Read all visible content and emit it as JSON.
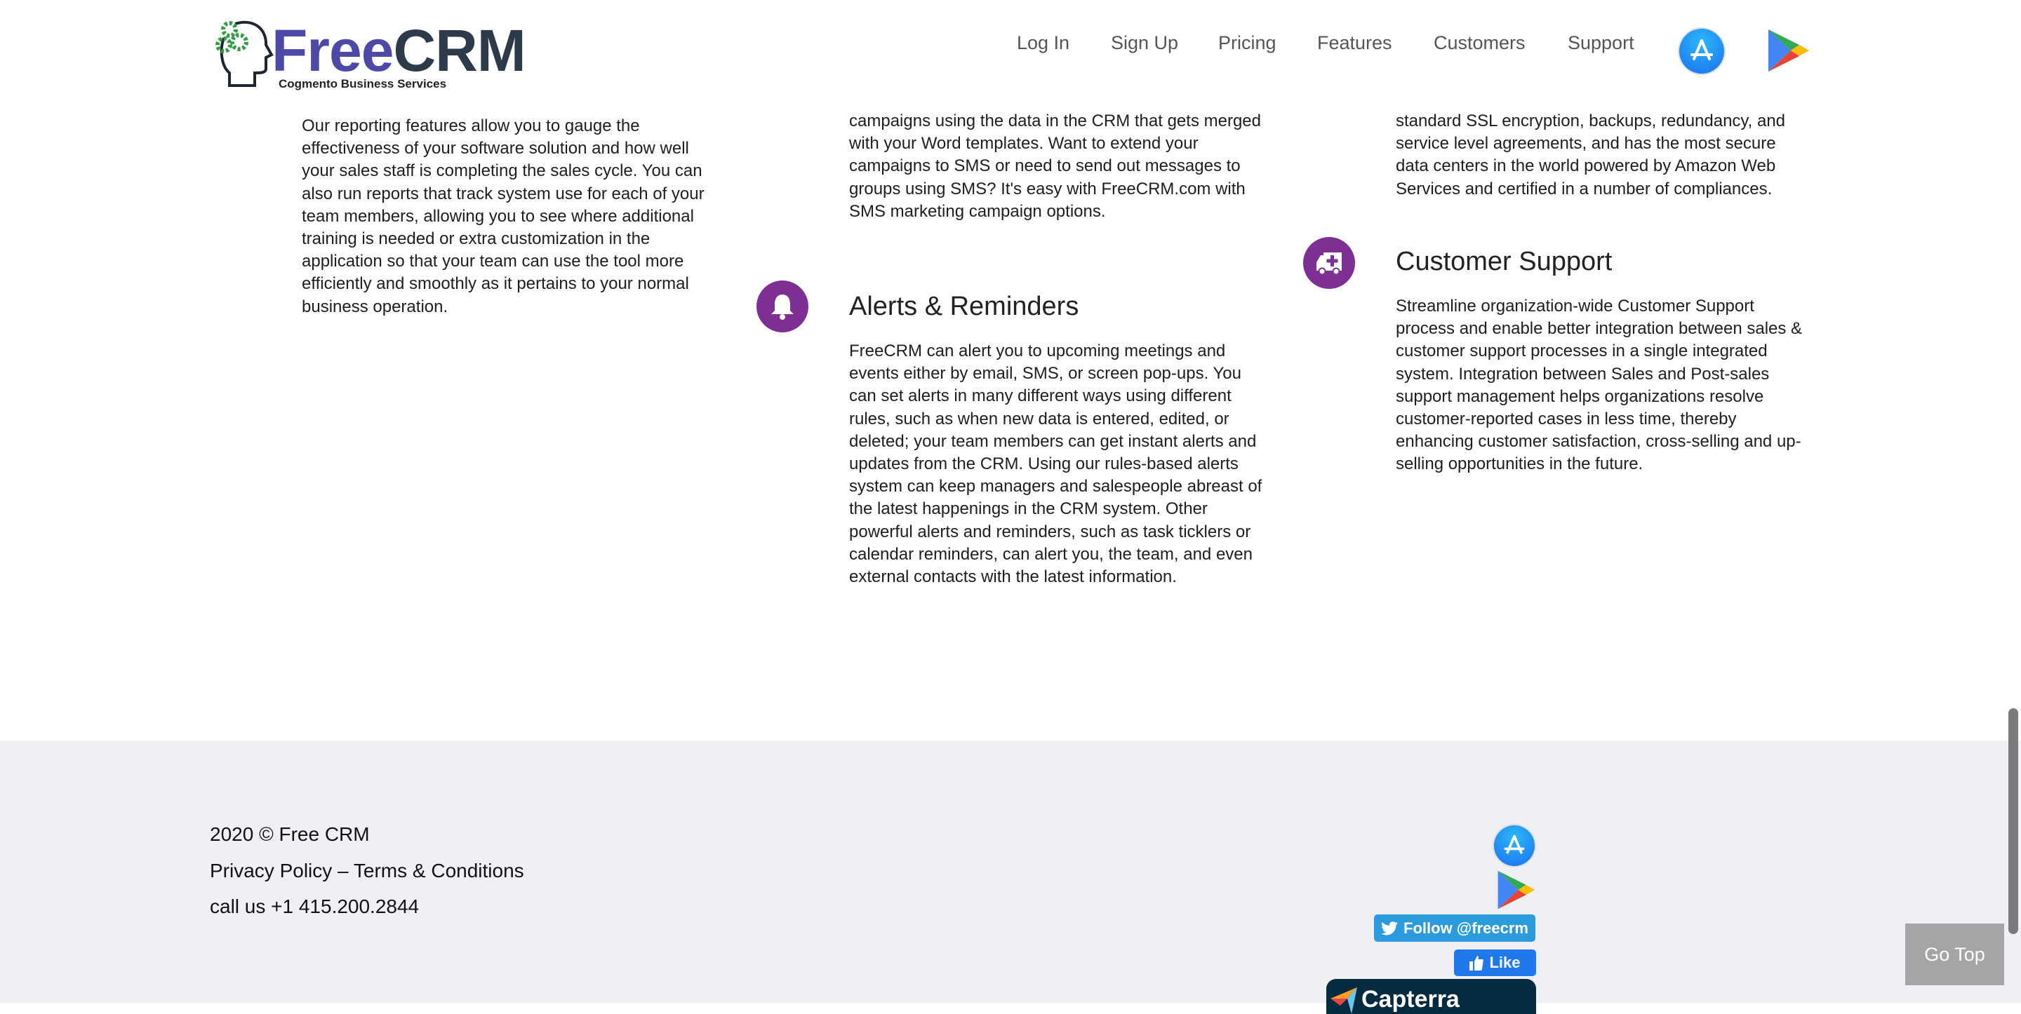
{
  "header": {
    "logo": {
      "brand_part1": "Free",
      "brand_part2": "CRM",
      "tagline": "Cogmento Business Services"
    },
    "nav": [
      {
        "label": "Log In"
      },
      {
        "label": "Sign Up"
      },
      {
        "label": "Pricing"
      },
      {
        "label": "Features"
      },
      {
        "label": "Customers"
      },
      {
        "label": "Support"
      }
    ],
    "store_icons": [
      "app-store-icon",
      "google-play-icon"
    ]
  },
  "features": {
    "col1": {
      "text": "Our reporting features allow you to gauge the effectiveness of your software solution and how well your sales staff is completing the sales cycle. You can also run reports that track system use for each of your team members, allowing you to see where additional training is needed or extra customization in the application so that your team can use the tool more efficiently and smoothly as it pertains to your normal business operation."
    },
    "col2": {
      "text_top": "campaigns using the data in the CRM that gets merged with your Word templates. Want to extend your campaigns to SMS or need to send out messages to groups using SMS? It's easy with FreeCRM.com with SMS marketing campaign options.",
      "title": "Alerts & Reminders",
      "icon": "bell-icon",
      "text": "FreeCRM can alert you to upcoming meetings and events either by email, SMS, or screen pop-ups. You can set alerts in many different ways using different rules, such as when new data is entered, edited, or deleted; your team members can get instant alerts and updates from the CRM. Using our rules-based alerts system can keep managers and salespeople abreast of the latest happenings in the CRM system. Other powerful alerts and reminders, such as task ticklers or calendar reminders, can alert you, the team, and even external contacts with the latest information."
    },
    "col3": {
      "text_top": "standard SSL encryption, backups, redundancy, and service level agreements, and has the most secure data centers in the world powered by Amazon Web Services and certified in a number of compliances.",
      "title": "Customer Support",
      "icon": "ambulance-icon",
      "text": "Streamline organization-wide Customer Support process and enable better integration between sales & customer support processes in a single integrated system. Integration between Sales and Post-sales support management helps organizations resolve customer-reported cases in less time, thereby enhancing customer satisfaction, cross-selling and up-selling opportunities in the future."
    },
    "icon_color": "#7e2f94"
  },
  "footer": {
    "copyright": "2020 © Free CRM",
    "privacy": "Privacy Policy",
    "separator": " – ",
    "terms": "Terms & Conditions",
    "phone": "call us +1 415.200.2844",
    "twitter_label": "Follow @freecrm",
    "facebook_label": "Like",
    "capterra_label": "Capterra",
    "go_top": "Go Top",
    "background": "#eef0f3"
  }
}
